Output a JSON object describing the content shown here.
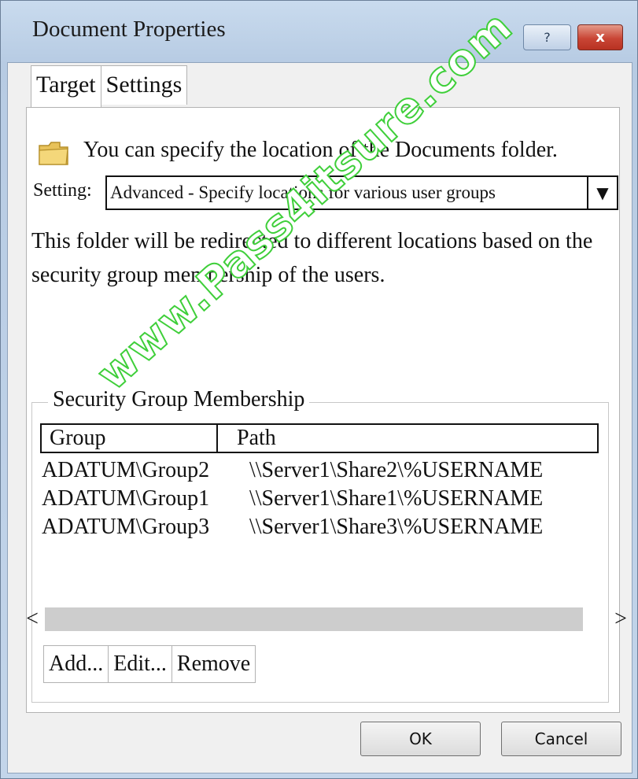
{
  "window": {
    "title": "Document Properties",
    "help_label": "?",
    "close_label": "x"
  },
  "tabs": [
    {
      "label": "Target",
      "active": true
    },
    {
      "label": "Settings",
      "active": false
    }
  ],
  "panel": {
    "intro_text": "You can specify the location of the Documents folder.",
    "setting_label": "Setting:",
    "setting_value": "Advanced - Specify locations for various user groups",
    "dropdown_arrow": "▼",
    "description": "This folder will be redirected to different locations based on the security group membership of the users."
  },
  "membership": {
    "legend": "Security Group Membership",
    "columns": {
      "group": "Group",
      "path": "Path"
    },
    "rows": [
      {
        "group": "ADATUM\\Group2",
        "path": "\\\\Server1\\Share2\\%USERNAME"
      },
      {
        "group": "ADATUM\\Group1",
        "path": "\\\\Server1\\Share1\\%USERNAME"
      },
      {
        "group": "ADATUM\\Group3",
        "path": "\\\\Server1\\Share3\\%USERNAME"
      }
    ],
    "scroll_left": "<",
    "scroll_right": ">",
    "buttons": {
      "add": "Add...",
      "edit": "Edit...",
      "remove": "Remove"
    }
  },
  "footer": {
    "ok": "OK",
    "cancel": "Cancel"
  },
  "watermark": "www.Pass4itsure.com",
  "colors": {
    "close_button": "#c94535",
    "watermark_outline": "#3fcf3a",
    "title_bar": "#c3d5ea"
  },
  "icons": {
    "folder": "folder-icon"
  }
}
